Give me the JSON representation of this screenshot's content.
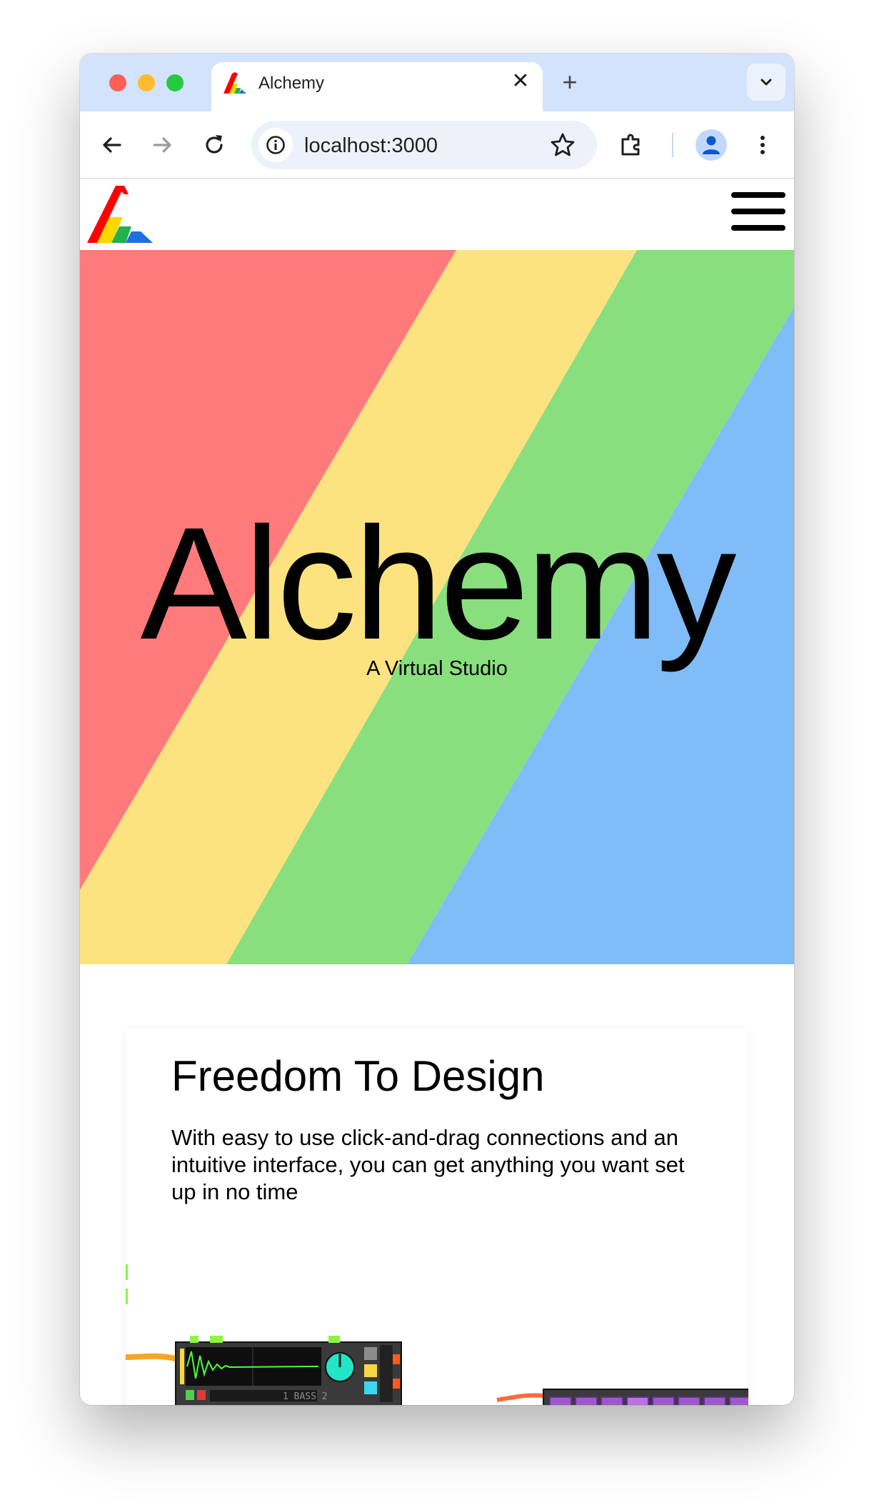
{
  "browser": {
    "tab_title": "Alchemy",
    "url": "localhost:3000",
    "tab_close_glyph": "✕",
    "new_tab_glyph": "+",
    "icons": [
      "back-arrow-icon",
      "forward-arrow-icon",
      "reload-icon",
      "site-info-icon",
      "bookmark-star-icon",
      "extensions-icon",
      "profile-icon",
      "kebab-menu-icon",
      "chevron-down-icon"
    ]
  },
  "site": {
    "hero": {
      "title": "Alchemy",
      "subtitle": "A Virtual Studio",
      "stripe_colors": [
        "#ff7b7b",
        "#fde37f",
        "#89df7e",
        "#80bcf7"
      ]
    },
    "feature": {
      "title": "Freedom To Design",
      "description": "With easy to use click-and-drag connections and an intuitive interface, you can get anything you want set up in no time",
      "preview_module_label": "1 BASS 2"
    },
    "logo_colors": [
      "#ff0000",
      "#ffd700",
      "#22b14c",
      "#1e6fe0"
    ]
  }
}
